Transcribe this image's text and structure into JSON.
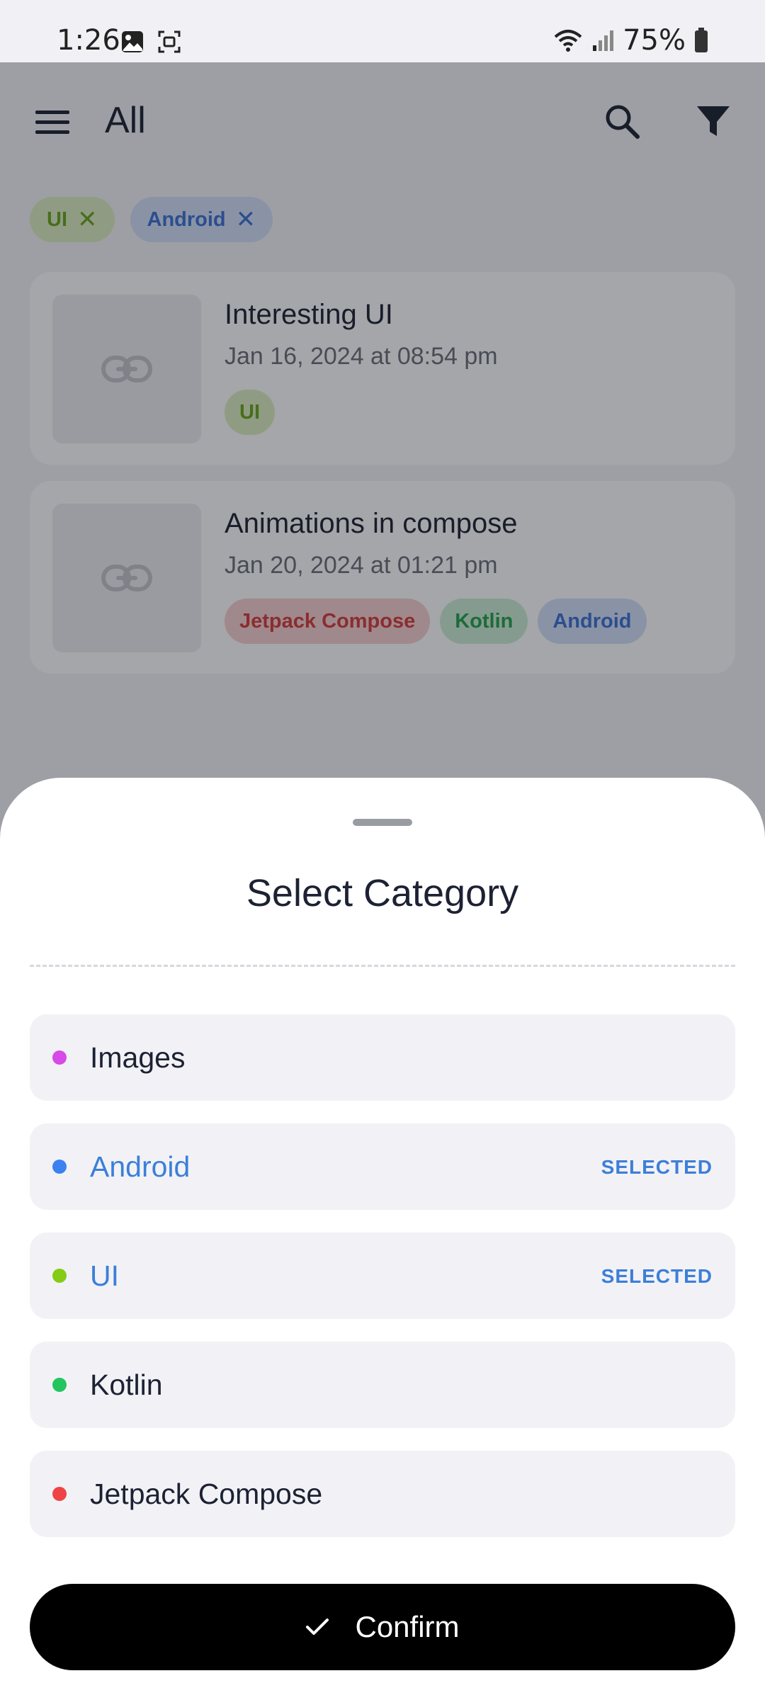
{
  "status_bar": {
    "time": "1:26",
    "battery": "75%"
  },
  "header": {
    "title": "All",
    "icons": [
      "menu-icon",
      "search-icon",
      "filter-icon"
    ]
  },
  "active_filters": [
    {
      "label": "UI",
      "color": "#6aa51c"
    },
    {
      "label": "Android",
      "color": "#3c72d6"
    }
  ],
  "cards": [
    {
      "title": "Interesting UI",
      "date": "Jan 16, 2024 at 08:54 pm",
      "tags": [
        "UI"
      ]
    },
    {
      "title": "Animations in compose",
      "date": "Jan 20, 2024 at 01:21 pm",
      "tags": [
        "Jetpack Compose",
        "Kotlin",
        "Android"
      ]
    }
  ],
  "sheet": {
    "title": "Select Category",
    "categories": [
      {
        "label": "Images",
        "color": "#d64be6",
        "badge": ""
      },
      {
        "label": "Android",
        "color": "#3b82f0",
        "badge": "SELECTED"
      },
      {
        "label": "UI",
        "color": "#84cc16",
        "badge": "SELECTED"
      },
      {
        "label": "Kotlin",
        "color": "#22c55e",
        "badge": ""
      },
      {
        "label": "Jetpack Compose",
        "color": "#ef4444",
        "badge": ""
      }
    ],
    "confirm_label": "Confirm"
  }
}
